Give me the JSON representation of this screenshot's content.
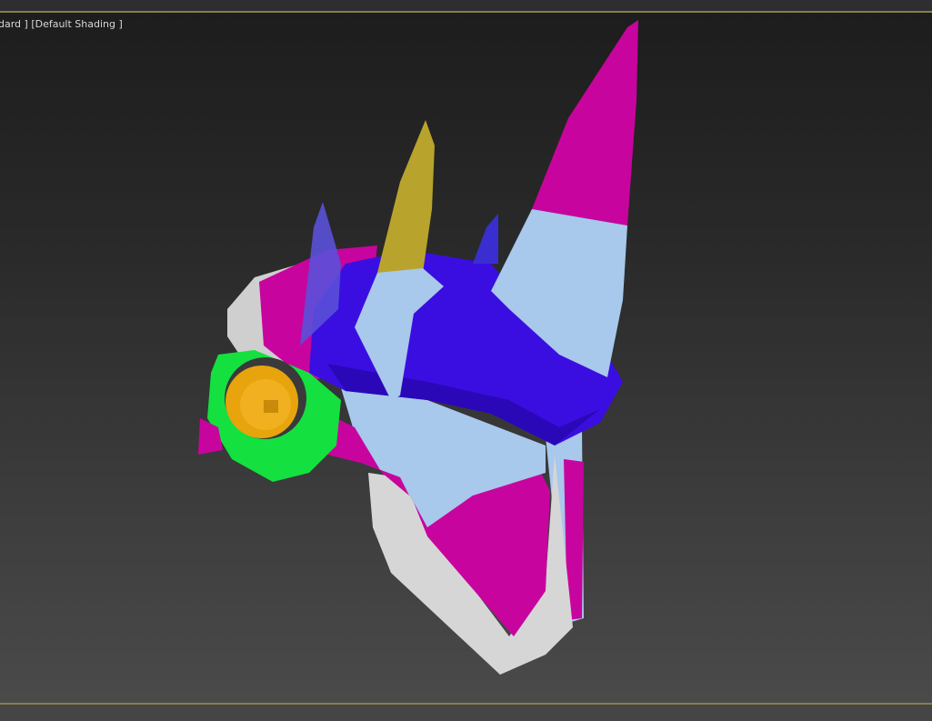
{
  "viewport": {
    "label": "dard ] [Default Shading ]"
  },
  "colors": {
    "magenta": "#c8049e",
    "blue": "#3a0ee0",
    "light_blue": "#a8c8ec",
    "yellow": "#b8a42c",
    "green": "#14e040",
    "orange": "#e8a40c",
    "white": "#d8d8d8",
    "frame": "#8b7c4b"
  }
}
